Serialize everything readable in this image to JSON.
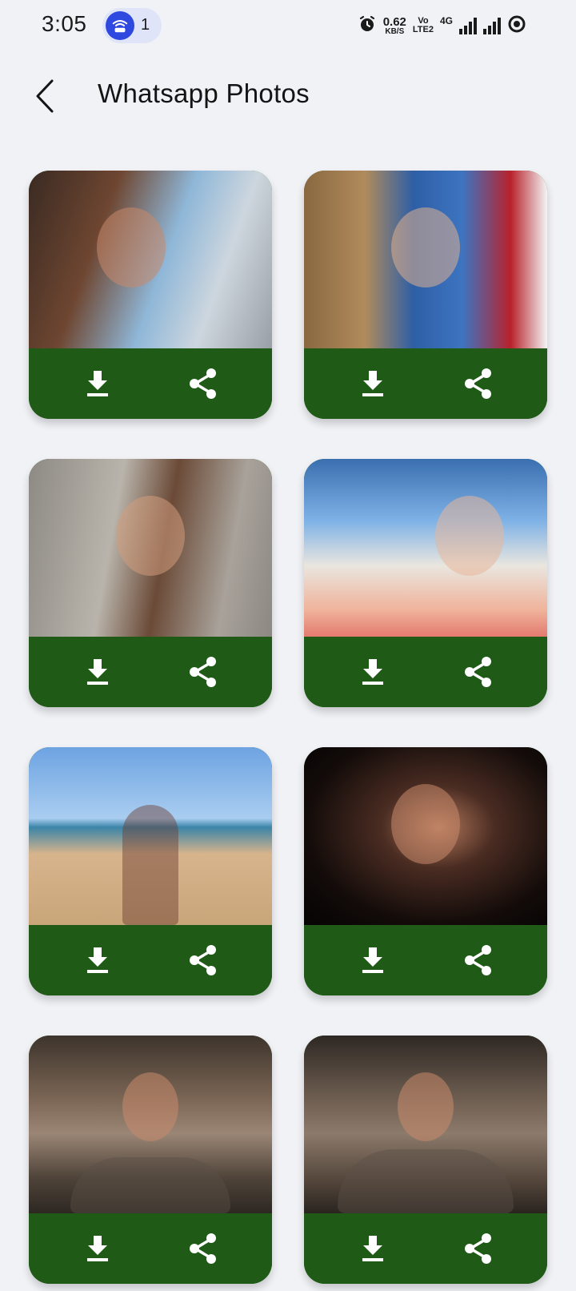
{
  "status_bar": {
    "time": "3:05",
    "hotspot_count": "1",
    "net_speed_value": "0.62",
    "net_speed_unit": "KB/S",
    "volte_top": "Vo",
    "volte_bottom": "LTE2",
    "network_type": "4G"
  },
  "app_bar": {
    "title": "Whatsapp Photos"
  },
  "grid": {
    "items": [
      {
        "photo": "photo-1",
        "download_icon": "download-icon",
        "share_icon": "share-icon"
      },
      {
        "photo": "photo-2",
        "download_icon": "download-icon",
        "share_icon": "share-icon"
      },
      {
        "photo": "photo-3",
        "download_icon": "download-icon",
        "share_icon": "share-icon"
      },
      {
        "photo": "photo-4",
        "download_icon": "download-icon",
        "share_icon": "share-icon"
      },
      {
        "photo": "photo-5",
        "download_icon": "download-icon",
        "share_icon": "share-icon"
      },
      {
        "photo": "photo-6",
        "download_icon": "download-icon",
        "share_icon": "share-icon"
      },
      {
        "photo": "photo-7",
        "download_icon": "download-icon",
        "share_icon": "share-icon"
      },
      {
        "photo": "photo-8",
        "download_icon": "download-icon",
        "share_icon": "share-icon"
      }
    ]
  },
  "colors": {
    "background": "#f1f2f6",
    "card_action_bar": "#1f5b17",
    "hotspot_accent": "#2f49e0",
    "icon": "#ffffff"
  }
}
